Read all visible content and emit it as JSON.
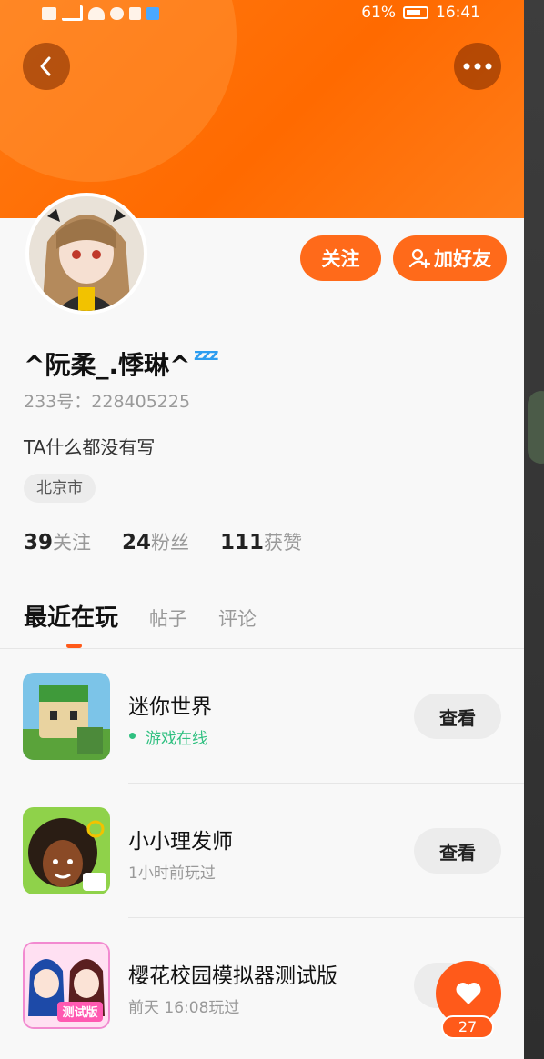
{
  "status_bar": {
    "left_icons": [
      "hd-icon",
      "5g-signal-icon",
      "wifi-icon",
      "message-icon",
      "book-icon",
      "music-icon"
    ],
    "battery_percent": "61%",
    "time": "16:41"
  },
  "profile": {
    "nickname": "^阮柔_.悸琳^",
    "zzz": "zzz",
    "uid": "233号：228405225",
    "bio": "TA什么都没有写",
    "location": "北京市",
    "follow_label": "关注",
    "add_friend_label": "加好友",
    "stats": [
      {
        "num": "39",
        "label": "关注"
      },
      {
        "num": "24",
        "label": "粉丝"
      },
      {
        "num": "111",
        "label": "获赞"
      }
    ]
  },
  "tabs": [
    {
      "label": "最近在玩",
      "active": true
    },
    {
      "label": "帖子",
      "active": false
    },
    {
      "label": "评论",
      "active": false
    }
  ],
  "games": [
    {
      "name": "迷你世界",
      "status": "游戏在线",
      "online": true,
      "action": "查看"
    },
    {
      "name": "小小理发师",
      "status": "1小时前玩过",
      "online": false,
      "action": "查看"
    },
    {
      "name": "樱花校园模拟器测试版",
      "status": "前天 16:08玩过",
      "online": false,
      "action": "查看"
    }
  ],
  "game3_badge": "测试版",
  "like": {
    "count": "27"
  },
  "colors": {
    "brand": "#ff6a1a",
    "online": "#2fc080",
    "zzz": "#2d9df0"
  }
}
